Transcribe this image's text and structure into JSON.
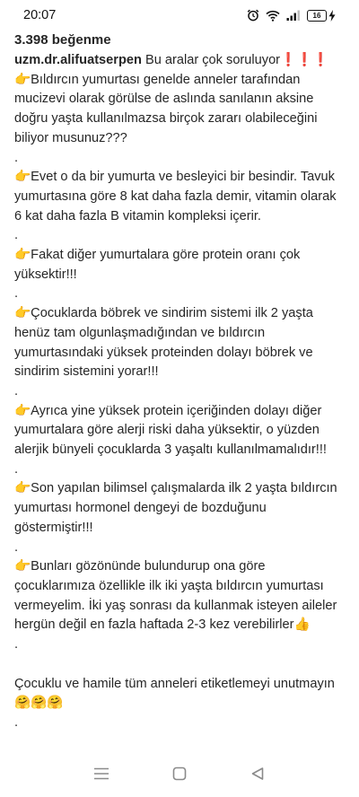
{
  "status_bar": {
    "time": "20:07",
    "battery": "16"
  },
  "post": {
    "likes": "3.398 beğenme",
    "username": "uzm.dr.alifuatserpen",
    "intro": "Bu aralar çok soruluyor❗❗❗",
    "paragraphs": [
      "👉Bıldırcın yumurtası genelde anneler tarafından mucizevi olarak görülse de aslında sanılanın aksine doğru yaşta kullanılmazsa birçok zararı olabileceğini biliyor musunuz???",
      ".",
      "👉Evet o da bir yumurta ve besleyici bir besindir. Tavuk yumurtasına göre 8 kat daha fazla demir, vitamin olarak 6 kat daha fazla B vitamin kompleksi içerir.",
      ".",
      "👉Fakat diğer yumurtalara göre protein oranı çok yüksektir!!!",
      ".",
      "👉Çocuklarda böbrek ve sindirim sistemi ilk 2 yaşta henüz tam olgunlaşmadığından ve bıldırcın yumurtasındaki yüksek proteinden dolayı böbrek ve sindirim sistemini yorar!!!",
      ".",
      "👉Ayrıca yine yüksek protein içeriğinden dolayı diğer yumurtalara göre alerji riski daha yüksektir, o yüzden alerjik bünyeli çocuklarda 3 yaşaltı kullanılmamalıdır!!!",
      ".",
      "👉Son yapılan bilimsel çalışmalarda ilk 2 yaşta bıldırcın yumurtası hormonel dengeyi de bozduğunu göstermiştir!!!",
      ".",
      "👉Bunları gözönünde bulundurup ona göre çocuklarımıza özellikle ilk iki yaşta bıldırcın yumurtası vermeyelim. İki yaş sonrası da kullanmak isteyen aileler hergün değil en fazla haftada 2-3 kez verebilirler👍",
      ".",
      "",
      "Çocuklu ve hamile tüm anneleri etiketlemeyi unutmayın🤗🤗🤗",
      "."
    ]
  }
}
